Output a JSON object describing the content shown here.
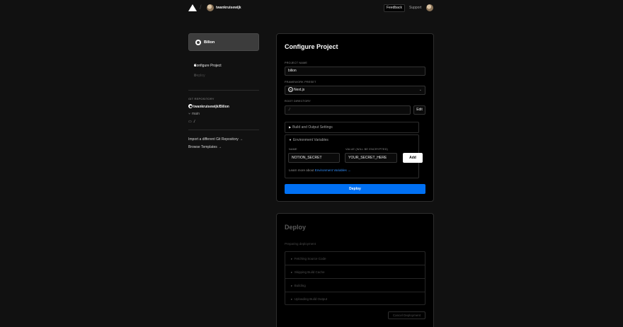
{
  "header": {
    "user_name": "twankruisewijk",
    "feedback_label": "Feedback",
    "support_label": "Support"
  },
  "sidebar": {
    "repo_card_name": "Bilion",
    "steps": [
      "Configure Project",
      "Deploy"
    ],
    "git_repository_label": "GIT REPOSITORY",
    "repo_full_name": "twankruisewijk/Bilion",
    "branch": "main",
    "directory": "./",
    "import_link": "Import a different Git Repository →",
    "browse_link": "Browse Templates →"
  },
  "configure": {
    "title": "Configure Project",
    "project_name_label": "PROJECT NAME",
    "project_name_value": "bilion",
    "framework_label": "FRAMEWORK PRESET",
    "framework_value": "Next.js",
    "root_label": "ROOT DIRECTORY",
    "root_value": "./",
    "edit_label": "Edit",
    "build_settings_label": "Build and Output Settings",
    "env_label": "Environment Variables",
    "env_name_label": "NAME",
    "env_value_label": "VALUE (WILL BE ENCRYPTED)",
    "env_name_value": "NOTION_SECRET",
    "env_value_value": "YOUR_SECRET_HERE",
    "add_label": "Add",
    "learn_more_prefix": "Learn more about",
    "learn_more_link": "Environment Variables →",
    "deploy_label": "Deploy"
  },
  "deploy_card": {
    "title": "Deploy",
    "status": "Preparing deployment",
    "steps": [
      "Fetching Source Code",
      "Skipping Build Cache",
      "Building",
      "Uploading Build Output"
    ],
    "cancel_label": "Cancel Deployment"
  },
  "colors": {
    "background": "#111111",
    "card": "#000000",
    "accent_blue": "#0070f3",
    "link_blue": "#3291ff"
  }
}
